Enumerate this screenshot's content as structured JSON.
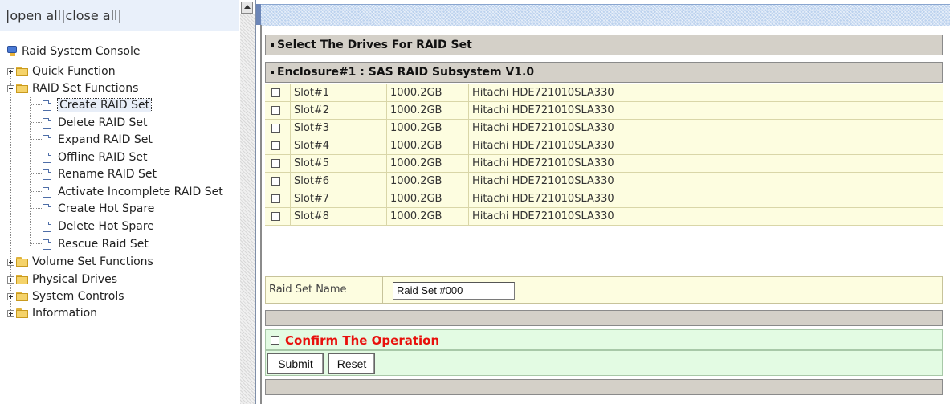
{
  "nav": {
    "open_all": "open all",
    "close_all": "close all",
    "separator": "|"
  },
  "tree": {
    "root": "Raid System Console",
    "quick_function": "Quick Function",
    "raid_set_functions": "RAID Set Functions",
    "raid_items": [
      "Create RAID Set",
      "Delete RAID Set",
      "Expand RAID Set",
      "Offline RAID Set",
      "Rename RAID Set",
      "Activate Incomplete RAID Set",
      "Create Hot Spare",
      "Delete Hot Spare",
      "Rescue Raid Set"
    ],
    "other_folders": [
      "Volume Set Functions",
      "Physical Drives",
      "System Controls",
      "Information"
    ]
  },
  "main": {
    "select_header": "Select The Drives For RAID Set",
    "enclosure_header": "Enclosure#1 : SAS RAID Subsystem V1.0",
    "drives": [
      {
        "slot": "Slot#1",
        "size": "1000.2GB",
        "model": "Hitachi HDE721010SLA330"
      },
      {
        "slot": "Slot#2",
        "size": "1000.2GB",
        "model": "Hitachi HDE721010SLA330"
      },
      {
        "slot": "Slot#3",
        "size": "1000.2GB",
        "model": "Hitachi HDE721010SLA330"
      },
      {
        "slot": "Slot#4",
        "size": "1000.2GB",
        "model": "Hitachi HDE721010SLA330"
      },
      {
        "slot": "Slot#5",
        "size": "1000.2GB",
        "model": "Hitachi HDE721010SLA330"
      },
      {
        "slot": "Slot#6",
        "size": "1000.2GB",
        "model": "Hitachi HDE721010SLA330"
      },
      {
        "slot": "Slot#7",
        "size": "1000.2GB",
        "model": "Hitachi HDE721010SLA330"
      },
      {
        "slot": "Slot#8",
        "size": "1000.2GB",
        "model": "Hitachi HDE721010SLA330"
      }
    ],
    "raid_set_name_label": "Raid Set Name",
    "raid_set_name_value": "Raid Set #000",
    "confirm_label": "Confirm The Operation",
    "submit_label": "Submit",
    "reset_label": "Reset"
  },
  "colors": {
    "confirm_text": "#e8100c",
    "drive_row_bg": "#fdfde0",
    "confirm_row_bg": "#e3fbe3",
    "header_bg": "#d4d0c8"
  }
}
